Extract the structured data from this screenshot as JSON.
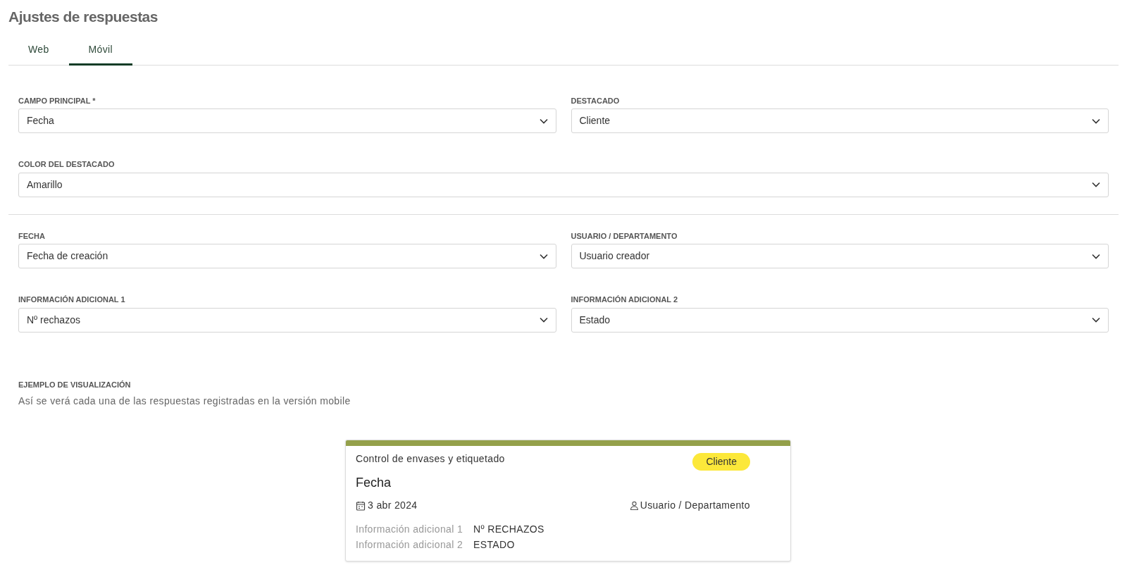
{
  "title": "Ajustes de respuestas",
  "tabs": [
    {
      "label": "Web",
      "selected": false
    },
    {
      "label": "Móvil",
      "selected": true
    }
  ],
  "field_sections": [
    {
      "rows": [
        [
          {
            "label": "CAMPO PRINCIPAL *",
            "value": "Fecha"
          },
          {
            "label": "DESTACADO",
            "value": "Cliente"
          }
        ],
        [
          {
            "label": "COLOR DEL DESTACADO",
            "value": "Amarillo"
          }
        ]
      ]
    },
    {
      "rows": [
        [
          {
            "label": "FECHA",
            "value": "Fecha de creación"
          },
          {
            "label": "USUARIO / DEPARTAMENTO",
            "value": "Usuario creador"
          }
        ],
        [
          {
            "label": "INFORMACIÓN ADICIONAL 1",
            "value": "Nº rechazos"
          },
          {
            "label": "INFORMACIÓN ADICIONAL 2",
            "value": "Estado"
          }
        ]
      ]
    }
  ],
  "preview": {
    "heading": "EJEMPLO DE VISUALIZACIÓN",
    "description": "Así se verá cada una de las respuestas registradas en la versión mobile",
    "card": {
      "form_name": "Control de envases y etiquetado",
      "highlight": "Cliente",
      "main_field": "Fecha",
      "date": "3 abr 2024",
      "user": "Usuario / Departamento",
      "extra": [
        {
          "label": "Información adicional 1",
          "value": "Nº RECHAZOS"
        },
        {
          "label": "Información adicional 2",
          "value": "ESTADO"
        }
      ]
    }
  }
}
